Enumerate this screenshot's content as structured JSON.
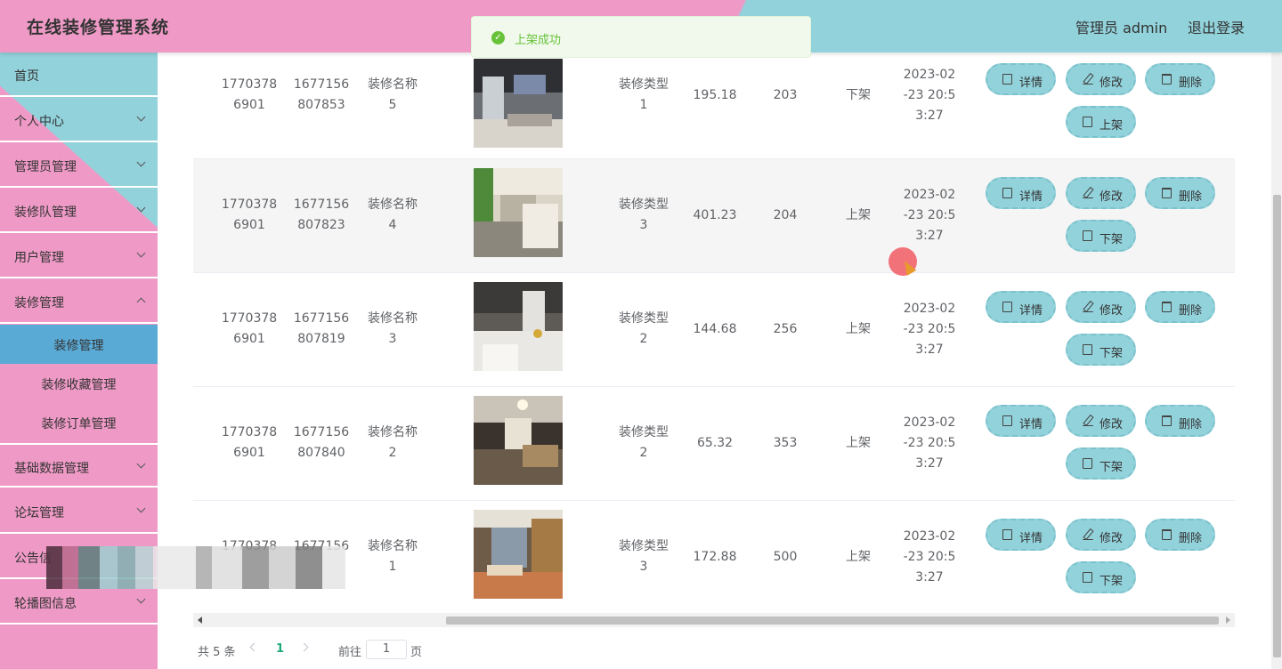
{
  "header": {
    "title": "在线装修管理系统",
    "user": "管理员 admin",
    "logout": "退出登录"
  },
  "toast": {
    "message": "上架成功"
  },
  "sidebar": {
    "items": [
      {
        "label": "首页"
      },
      {
        "label": "个人中心"
      },
      {
        "label": "管理员管理"
      },
      {
        "label": "装修队管理"
      },
      {
        "label": "用户管理"
      },
      {
        "label": "装修管理"
      },
      {
        "label": "装修管理"
      },
      {
        "label": "装修收藏管理"
      },
      {
        "label": "装修订单管理"
      },
      {
        "label": "基础数据管理"
      },
      {
        "label": "论坛管理"
      },
      {
        "label": "公告信"
      },
      {
        "label": "轮播图信息"
      }
    ]
  },
  "table": {
    "rows": [
      {
        "team_line1": "1770378",
        "team_line2": "6901",
        "code_line1": "1677156",
        "code_line2": "807853",
        "name_line1": "装修名称",
        "name_line2": "5",
        "type_line1": "装修类型",
        "type_line2": "1",
        "price": "195.18",
        "clicks": "203",
        "status": "下架",
        "time_line1": "2023-02",
        "time_line2": "-23 20:5",
        "time_line3": "3:27",
        "btn_detail": "详情",
        "btn_edit": "修改",
        "btn_delete": "删除",
        "btn_toggle": "上架"
      },
      {
        "team_line1": "1770378",
        "team_line2": "6901",
        "code_line1": "1677156",
        "code_line2": "807823",
        "name_line1": "装修名称",
        "name_line2": "4",
        "type_line1": "装修类型",
        "type_line2": "3",
        "price": "401.23",
        "clicks": "204",
        "status": "上架",
        "time_line1": "2023-02",
        "time_line2": "-23 20:5",
        "time_line3": "3:27",
        "btn_detail": "详情",
        "btn_edit": "修改",
        "btn_delete": "删除",
        "btn_toggle": "下架"
      },
      {
        "team_line1": "1770378",
        "team_line2": "6901",
        "code_line1": "1677156",
        "code_line2": "807819",
        "name_line1": "装修名称",
        "name_line2": "3",
        "type_line1": "装修类型",
        "type_line2": "2",
        "price": "144.68",
        "clicks": "256",
        "status": "上架",
        "time_line1": "2023-02",
        "time_line2": "-23 20:5",
        "time_line3": "3:27",
        "btn_detail": "详情",
        "btn_edit": "修改",
        "btn_delete": "删除",
        "btn_toggle": "下架"
      },
      {
        "team_line1": "1770378",
        "team_line2": "6901",
        "code_line1": "1677156",
        "code_line2": "807840",
        "name_line1": "装修名称",
        "name_line2": "2",
        "type_line1": "装修类型",
        "type_line2": "2",
        "price": "65.32",
        "clicks": "353",
        "status": "上架",
        "time_line1": "2023-02",
        "time_line2": "-23 20:5",
        "time_line3": "3:27",
        "btn_detail": "详情",
        "btn_edit": "修改",
        "btn_delete": "删除",
        "btn_toggle": "下架"
      },
      {
        "team_line1": "1770378",
        "team_line2": "",
        "code_line1": "1677156",
        "code_line2": "",
        "name_line1": "装修名称",
        "name_line2": "1",
        "type_line1": "装修类型",
        "type_line2": "3",
        "price": "172.88",
        "clicks": "500",
        "status": "上架",
        "time_line1": "2023-02",
        "time_line2": "-23 20:5",
        "time_line3": "3:27",
        "btn_detail": "详情",
        "btn_edit": "修改",
        "btn_delete": "删除",
        "btn_toggle": "下架"
      }
    ]
  },
  "pagination": {
    "total": "共 5 条",
    "current": "1",
    "goto": "前往",
    "jump_value": "1",
    "unit": "页"
  },
  "colors": {
    "pink": "#ef9ac6",
    "teal": "#92d2db",
    "active": "#5aaad6",
    "success": "#67c23a"
  }
}
